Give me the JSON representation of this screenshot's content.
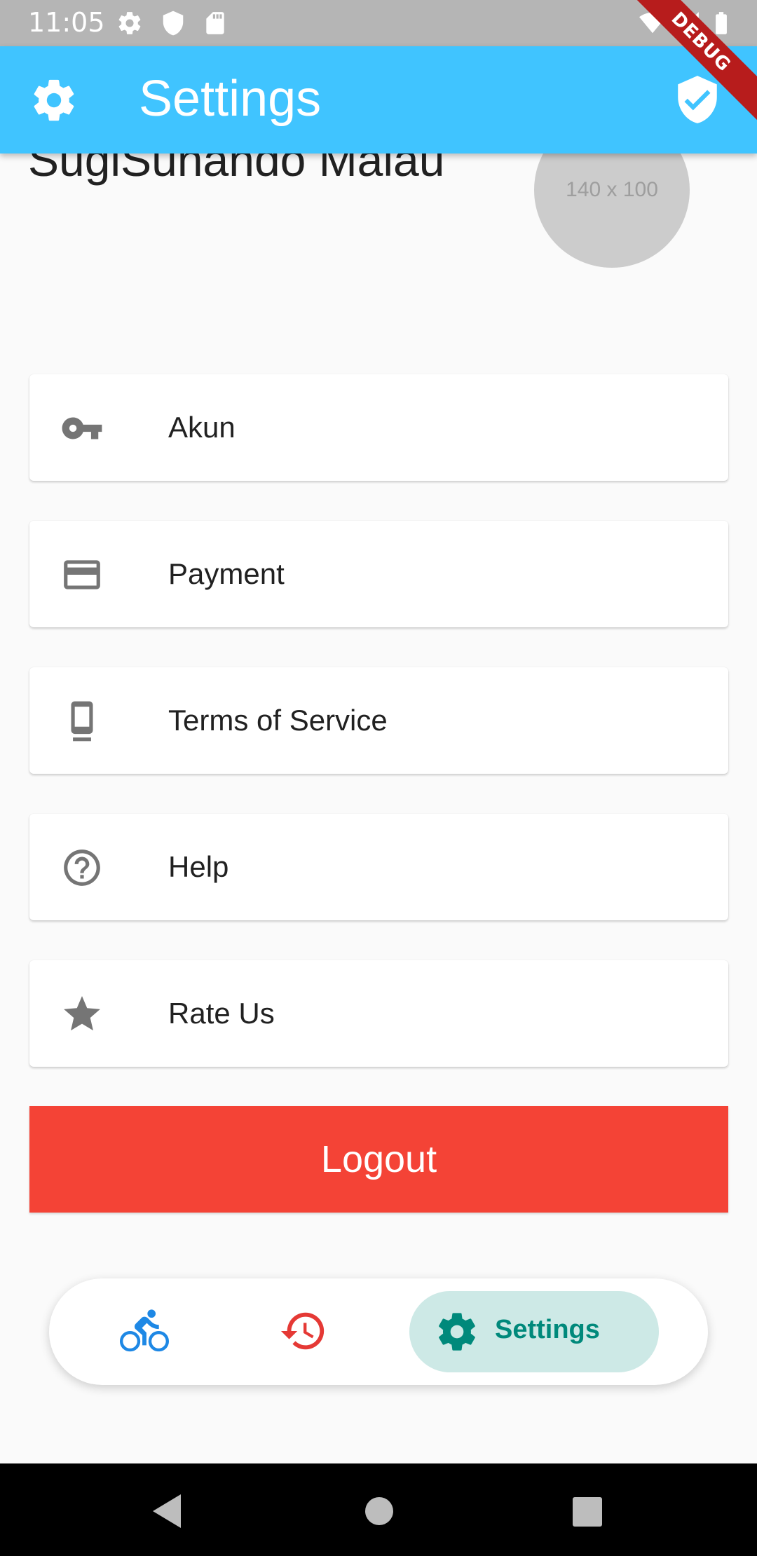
{
  "status_bar": {
    "time": "11:05",
    "left_icons": [
      "gear-icon",
      "shield-icon",
      "sd-card-icon"
    ],
    "right_icons": [
      "wifi-icon",
      "cell-signal-icon",
      "battery-icon"
    ]
  },
  "debug_banner": "DEBUG",
  "app_bar": {
    "title": "Settings",
    "leading_icon": "gear-icon",
    "trailing_icon": "verified-shield-icon",
    "background": "#40c4ff"
  },
  "profile": {
    "name": "SugiSunando Malau",
    "avatar_placeholder": "140 x 100"
  },
  "menu": {
    "items": [
      {
        "label": "Akun",
        "icon": "key-icon"
      },
      {
        "label": "Payment",
        "icon": "credit-card-icon"
      },
      {
        "label": "Terms of Service",
        "icon": "phone-icon"
      },
      {
        "label": "Help",
        "icon": "help-circle-icon"
      },
      {
        "label": "Rate Us",
        "icon": "star-icon"
      }
    ]
  },
  "logout": {
    "label": "Logout",
    "color": "#f44336"
  },
  "bottom_nav": {
    "items": [
      {
        "icon": "bicycle-icon",
        "color": "#1e88e5",
        "active": false
      },
      {
        "icon": "history-icon",
        "color": "#e53935",
        "active": false
      },
      {
        "icon": "gear-icon",
        "label": "Settings",
        "color": "#00897b",
        "active": true
      }
    ]
  }
}
